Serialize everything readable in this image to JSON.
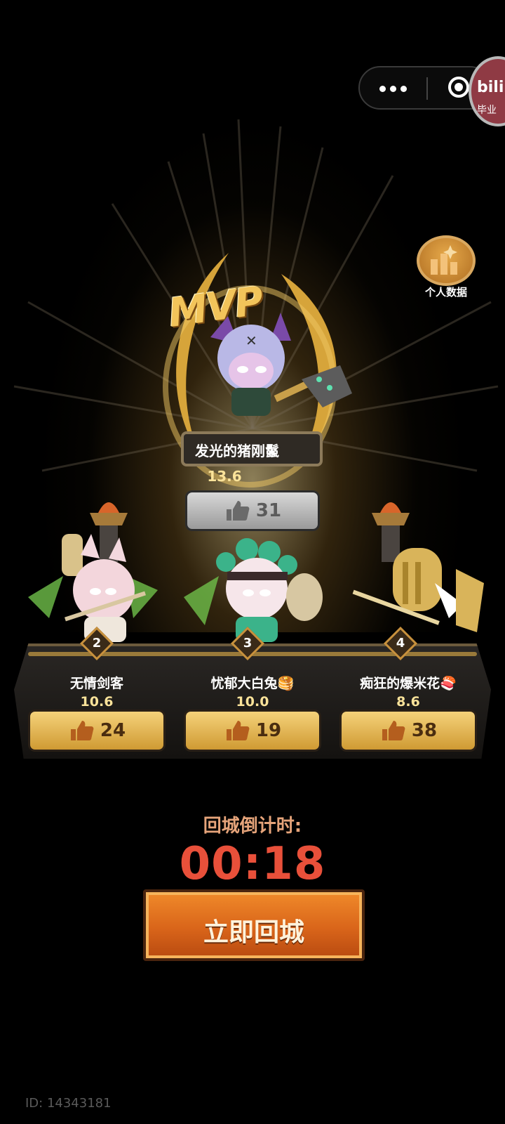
{
  "mvp": {
    "badge_text": "MVP",
    "name": "发光的猪刚鬣",
    "score": "13.6",
    "likes": "31"
  },
  "personal_data": {
    "label": "个人数据"
  },
  "players": [
    {
      "rank": "2",
      "name": "无情剑客",
      "score": "10.6",
      "likes": "24"
    },
    {
      "rank": "3",
      "name": "忧郁大白兔🥞",
      "score": "10.0",
      "likes": "19"
    },
    {
      "rank": "4",
      "name": "痴狂的爆米花🍣",
      "score": "8.6",
      "likes": "38"
    }
  ],
  "countdown": {
    "label": "回城倒计时:",
    "time": "00:18",
    "button_label": "立即回城"
  },
  "footer": {
    "id_text": "ID: 14343181"
  },
  "capsule": {
    "more_icon": "more-dots-icon",
    "close_icon": "target-close-icon"
  },
  "badge": {
    "line1": "bili",
    "line2": "毕业"
  },
  "colors": {
    "background": "#000000",
    "gold": "#f2c45a",
    "countdown_red": "#e8503a",
    "button_orange": "#e07020"
  }
}
